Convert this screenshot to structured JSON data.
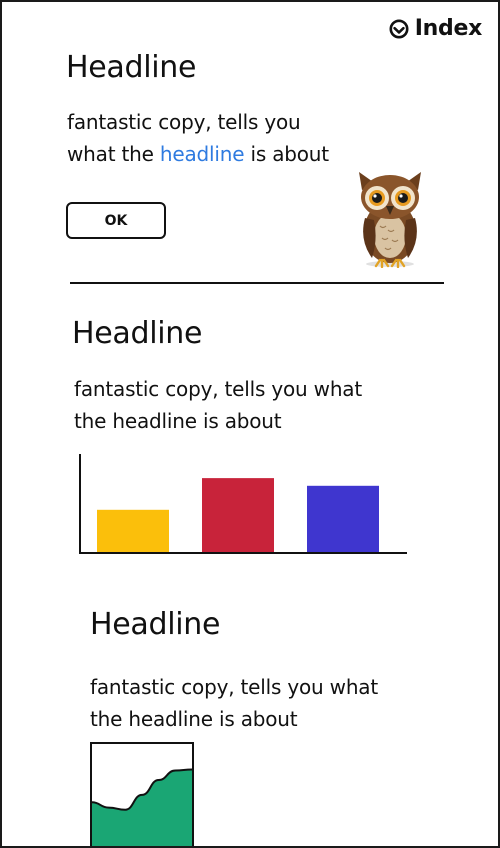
{
  "brand": {
    "name": "Index",
    "icon": "smile-circle-icon"
  },
  "section1": {
    "headline": "Headline",
    "copy_line1": "fantastic copy, tells you",
    "copy_line2_before": "what the ",
    "copy_link": "headline",
    "copy_line2_after": " is about",
    "button_label": "OK",
    "illustration": "owl-icon",
    "link_color": "#2f7be0"
  },
  "section2": {
    "headline": "Headline",
    "copy_line1": "fantastic copy, tells you what",
    "copy_line2": "the headline is about"
  },
  "section3": {
    "headline": "Headline",
    "copy_line1": "fantastic copy, tells you what",
    "copy_line2": "the headline is about"
  },
  "chart_data": [
    {
      "type": "bar",
      "categories": [
        "",
        "",
        ""
      ],
      "values": [
        45,
        78,
        70
      ],
      "colors": [
        "#fbbf0b",
        "#c8233a",
        "#3f36cf"
      ],
      "title": "",
      "xlabel": "",
      "ylabel": "",
      "ylim": [
        0,
        100
      ],
      "grid": false
    },
    {
      "type": "area",
      "x": [
        0,
        1,
        2,
        3,
        4,
        5,
        6
      ],
      "values": [
        45,
        40,
        38,
        52,
        66,
        75,
        76
      ],
      "colors": [
        "#1aa674"
      ],
      "title": "",
      "xlabel": "",
      "ylabel": "",
      "ylim": [
        0,
        100
      ],
      "grid": false
    }
  ]
}
